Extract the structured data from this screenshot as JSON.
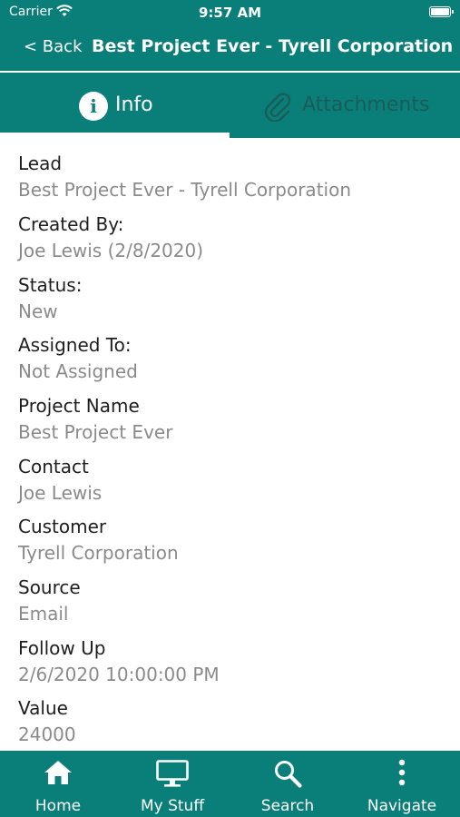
{
  "status_bar": {
    "carrier": "Carrier",
    "time": "9:57 AM"
  },
  "nav": {
    "back_label": "< Back",
    "title": "Best Project Ever - Tyrell Corporation"
  },
  "tabs": [
    {
      "label": "Info",
      "active": true
    },
    {
      "label": "Attachments",
      "active": false
    }
  ],
  "fields": [
    {
      "label": "Lead",
      "value": "Best Project Ever - Tyrell Corporation"
    },
    {
      "label": "Created By:",
      "value": "Joe Lewis (2/8/2020)"
    },
    {
      "label": "Status:",
      "value": "New"
    },
    {
      "label": "Assigned To:",
      "value": "Not Assigned"
    },
    {
      "label": "Project Name",
      "value": "Best Project Ever"
    },
    {
      "label": "Contact",
      "value": "Joe Lewis"
    },
    {
      "label": "Customer",
      "value": "Tyrell Corporation"
    },
    {
      "label": "Source",
      "value": "Email"
    },
    {
      "label": "Follow Up",
      "value": "2/6/2020 10:00:00 PM"
    },
    {
      "label": "Value",
      "value": "24000"
    }
  ],
  "tab_bar": [
    {
      "label": "Home",
      "icon": "home-icon"
    },
    {
      "label": "My Stuff",
      "icon": "monitor-icon"
    },
    {
      "label": "Search",
      "icon": "search-icon"
    },
    {
      "label": "Navigate",
      "icon": "more-vertical-icon"
    }
  ],
  "colors": {
    "brand": "#0a7f7a",
    "value_text": "#8a8a8a",
    "label_text": "#1e1e1e",
    "inactive_tab": "#1a5c58"
  }
}
